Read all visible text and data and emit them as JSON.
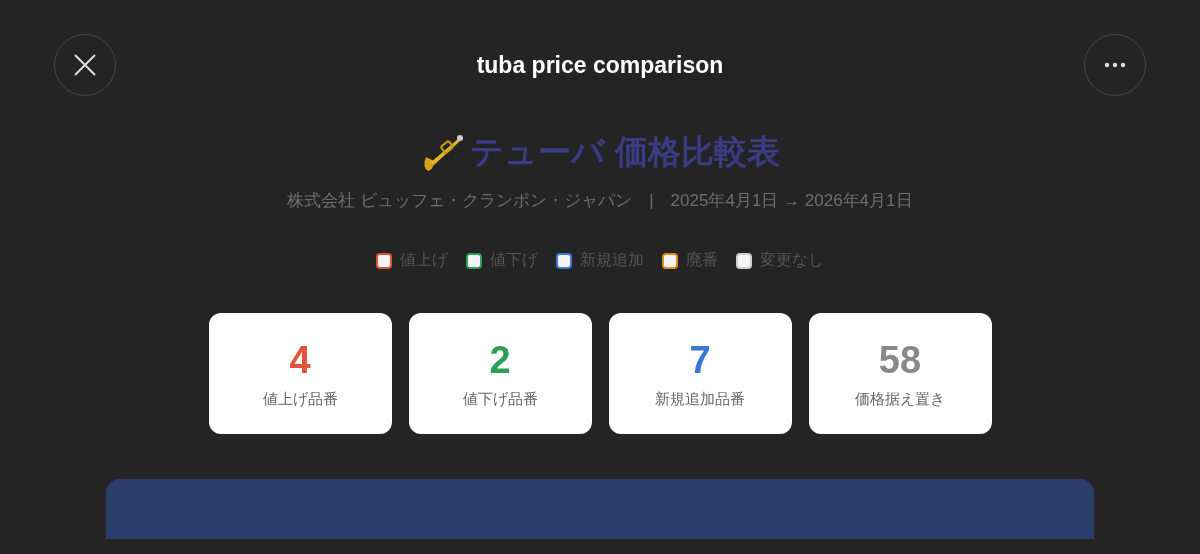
{
  "window": {
    "title": "tuba price comparison"
  },
  "heading": {
    "title": "テューバ 価格比較表",
    "subtitle": "株式会社 ビュッフェ・クランポン・ジャパン　|　2025年4月1日 → 2026年4月1日"
  },
  "legend": [
    {
      "label": "値上げ",
      "color": "#e0553a"
    },
    {
      "label": "値下げ",
      "color": "#2e9e5b"
    },
    {
      "label": "新規追加",
      "color": "#3a78d6"
    },
    {
      "label": "廃番",
      "color": "#e08a1e"
    },
    {
      "label": "変更なし",
      "color": "#cfcfcf"
    }
  ],
  "stats": [
    {
      "value": "4",
      "label": "値上げ品番",
      "color": "#e0553a"
    },
    {
      "value": "2",
      "label": "値下げ品番",
      "color": "#2e9e5b"
    },
    {
      "value": "7",
      "label": "新規追加品番",
      "color": "#3a78d6"
    },
    {
      "value": "58",
      "label": "価格据え置き",
      "color": "#888888"
    }
  ]
}
